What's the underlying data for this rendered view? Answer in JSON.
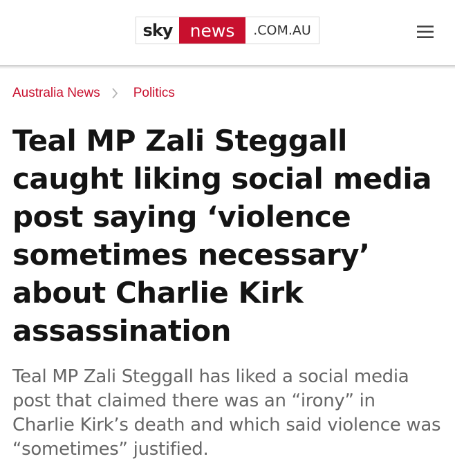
{
  "header": {
    "logo": {
      "sky": "sky",
      "news": "news",
      "domain": ".COM.AU"
    },
    "menu_icon": "hamburger-menu-icon",
    "brand_color": "#c8102e"
  },
  "breadcrumb": {
    "items": [
      {
        "label": "Australia News"
      },
      {
        "label": "Politics"
      }
    ],
    "separator_icon": "chevron-right-icon"
  },
  "article": {
    "headline": "Teal MP Zali Steggall caught liking social media post saying ‘violence sometimes necessary’ about Charlie Kirk assassination",
    "standfirst": "Teal MP Zali Steggall has liked a social media post that claimed there was an “irony” in Charlie Kirk’s death and which said violence was “sometimes” justified."
  }
}
